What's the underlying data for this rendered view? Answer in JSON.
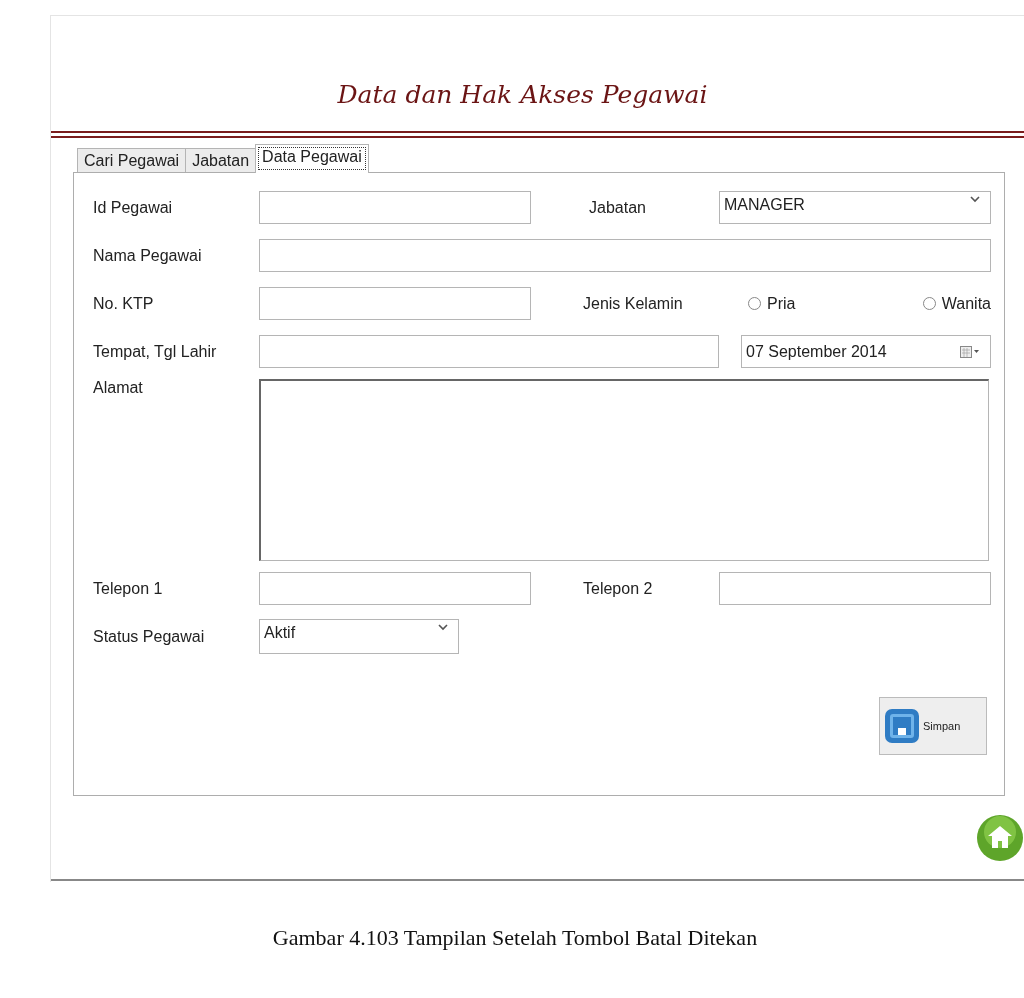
{
  "title": "Data dan Hak Akses Pegawai",
  "tabs": [
    {
      "label": "Cari Pegawai",
      "selected": false
    },
    {
      "label": "Jabatan",
      "selected": false
    },
    {
      "label": "Data Pegawai",
      "selected": true
    }
  ],
  "form": {
    "id_pegawai": {
      "label": "Id Pegawai"
    },
    "jabatan": {
      "label": "Jabatan",
      "value": "MANAGER"
    },
    "nama_pegawai": {
      "label": "Nama Pegawai"
    },
    "no_ktp": {
      "label": "No. KTP"
    },
    "jenis_kelamin": {
      "label": "Jenis Kelamin",
      "options": [
        {
          "label": "Pria",
          "selected": false
        },
        {
          "label": "Wanita",
          "selected": false
        }
      ]
    },
    "tempat_tgl_lahir": {
      "label": "Tempat, Tgl Lahir"
    },
    "tanggal_lahir": {
      "value": "07 September 2014"
    },
    "alamat": {
      "label": "Alamat"
    },
    "telepon_1": {
      "label": "Telepon 1"
    },
    "telepon_2": {
      "label": "Telepon 2"
    },
    "status_pegawai": {
      "label": "Status Pegawai",
      "value": "Aktif"
    }
  },
  "save_button": {
    "label": "Simpan"
  },
  "caption": "Gambar 4.103 Tampilan Setelah Tombol Batal Ditekan"
}
